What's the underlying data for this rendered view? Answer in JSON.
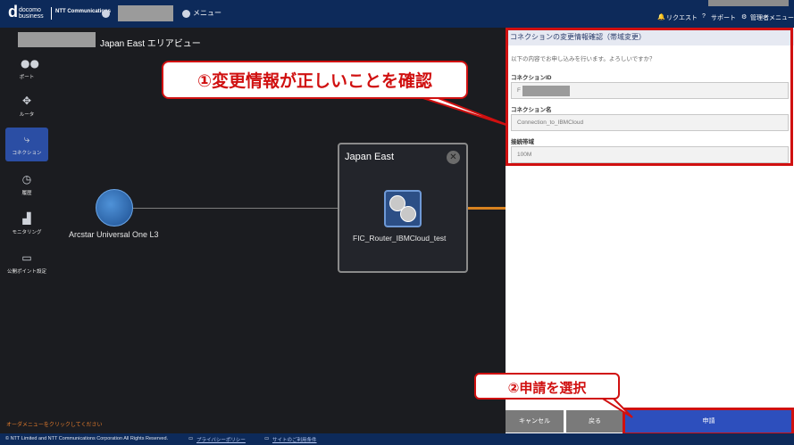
{
  "header": {
    "logo_mark": "d",
    "logo_line1": "docomo",
    "logo_line2": "business",
    "ntt_label": "NTT Communications",
    "nav_menu": "メニュー",
    "request": "リクエスト",
    "support": "サポート",
    "admin_menu": "管理者メニュー"
  },
  "area": {
    "title": "Japan East エリアビュー"
  },
  "sidebar": {
    "items": [
      {
        "label": "ポート",
        "icon": "port-icon"
      },
      {
        "label": "ルータ",
        "icon": "router-icon"
      },
      {
        "label": "コネクション",
        "icon": "connection-icon"
      },
      {
        "label": "履歴",
        "icon": "history-icon"
      },
      {
        "label": "モニタリング",
        "icon": "monitoring-icon"
      },
      {
        "label": "公開ポイント設定",
        "icon": "public-point-icon"
      }
    ]
  },
  "canvas": {
    "globe_label": "Arcstar Universal One L3",
    "region_title": "Japan East",
    "router_label": "FIC_Router_IBMCloud_test"
  },
  "callouts": {
    "step1": "①変更情報が正しいことを確認",
    "step2": "②申請を選択"
  },
  "panel": {
    "title": "コネクションの変更情報確認（帯域変更）",
    "subtitle": "以下の内容でお申し込みを行います。よろしいですか？",
    "fields": [
      {
        "label": "コネクションID",
        "value": "F"
      },
      {
        "label": "コネクション名",
        "value": "Connection_to_IBMCloud"
      },
      {
        "label": "接続帯域",
        "value": "100M"
      }
    ]
  },
  "buttons": {
    "cancel": "キャンセル",
    "back": "戻る",
    "apply": "申請"
  },
  "order_message": "オーダメニューをクリックしてください",
  "footer": {
    "copyright": "© NTT Limited and NTT Communications Corporation All Rights Reserved.",
    "privacy": "プライバシーポリシー",
    "terms": "サイトのご利用条件"
  },
  "colors": {
    "topbar": "#0d2a5a",
    "accent_blue": "#2d4fbd",
    "highlight_red": "#d01010",
    "link_orange": "#d8821f"
  }
}
